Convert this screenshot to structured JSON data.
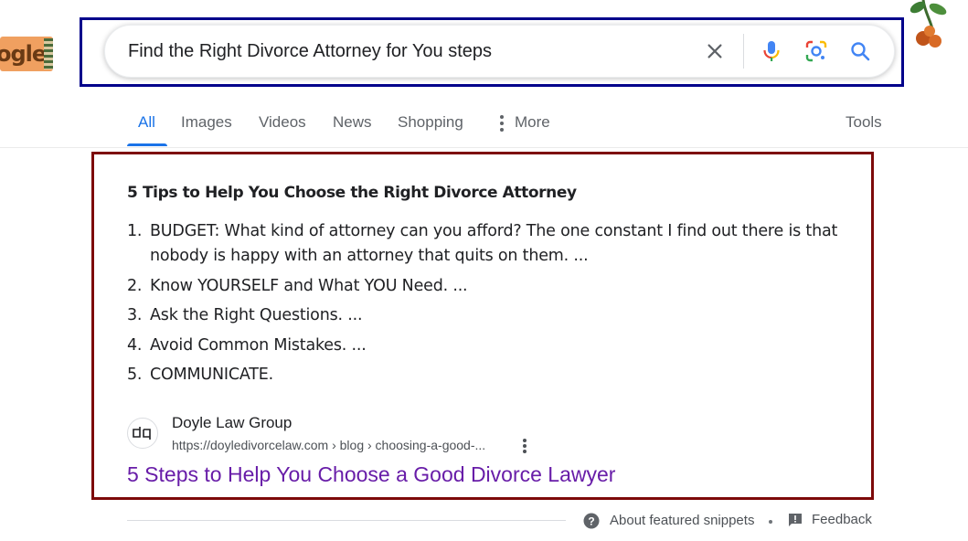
{
  "logo": {
    "text": "ogle"
  },
  "search": {
    "query": "Find the Right Divorce Attorney for You steps",
    "clear_icon": "close-icon",
    "voice_icon": "mic-icon",
    "lens_icon": "camera-lens-icon",
    "search_icon": "search-icon"
  },
  "tabs": {
    "items": [
      {
        "label": "All",
        "active": true
      },
      {
        "label": "Images"
      },
      {
        "label": "Videos"
      },
      {
        "label": "News"
      },
      {
        "label": "Shopping"
      },
      {
        "label": "More"
      }
    ],
    "tools_label": "Tools"
  },
  "snippet": {
    "title": "5 Tips to Help You Choose the Right Divorce Attorney",
    "items": [
      {
        "num": "1.",
        "text": "BUDGET: What kind of attorney can you afford? The one constant I find out there is that nobody is happy with an attorney that quits on them. ..."
      },
      {
        "num": "2.",
        "text": "Know YOURSELF and What YOU Need. ..."
      },
      {
        "num": "3.",
        "text": "Ask the Right Questions. ..."
      },
      {
        "num": "4.",
        "text": "Avoid Common Mistakes. ..."
      },
      {
        "num": "5.",
        "text": "COMMUNICATE."
      }
    ],
    "source": {
      "favicon_text": "dq",
      "name": "Doyle Law Group",
      "url": "https://doyledivorcelaw.com › blog › choosing-a-good-..."
    },
    "link": "5 Steps to Help You Choose a Good Divorce Lawyer"
  },
  "footer": {
    "about": "About featured snippets",
    "separator": "•",
    "feedback": "Feedback"
  },
  "colors": {
    "search_highlight_border": "#00008b",
    "snippet_highlight_border": "#7d0a0a",
    "accent_blue": "#1a73e8",
    "visited_link": "#681da8"
  }
}
